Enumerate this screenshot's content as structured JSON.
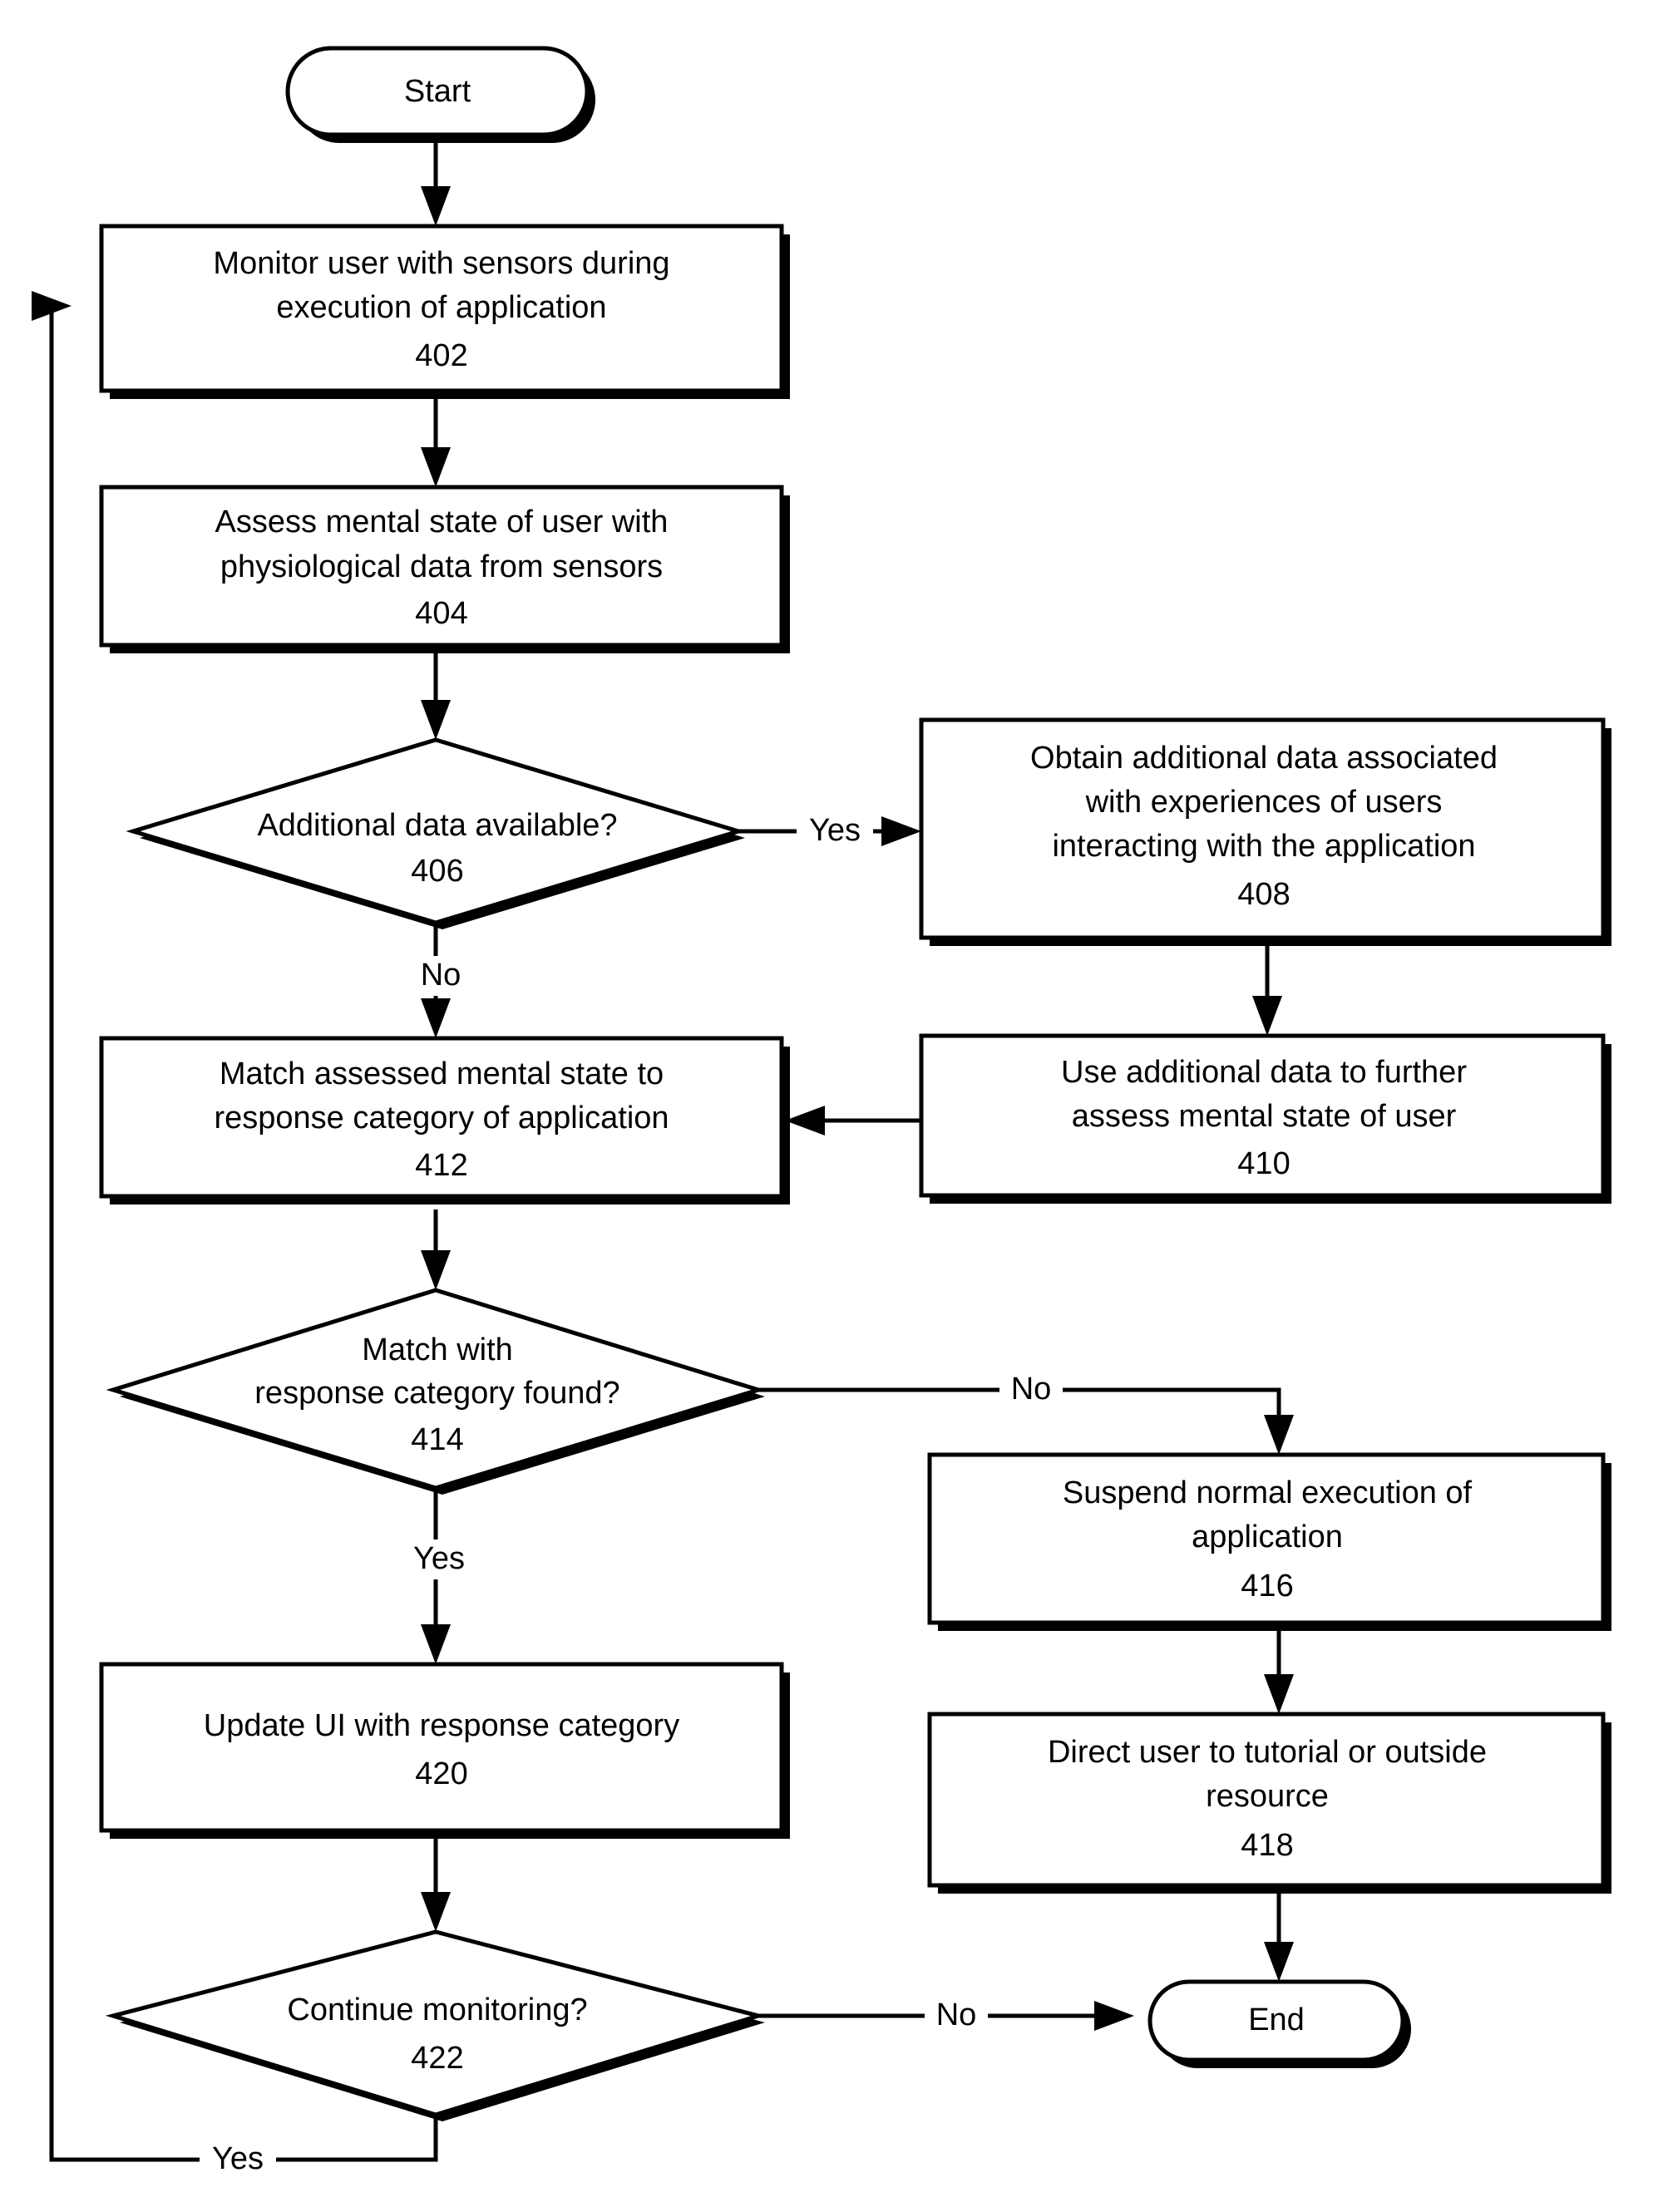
{
  "diagram": {
    "type": "flowchart",
    "title": "",
    "orientation": "top-to-bottom",
    "nodes": [
      {
        "id": "start",
        "shape": "terminator",
        "lines": [
          "Start"
        ],
        "ref": ""
      },
      {
        "id": "n402",
        "shape": "process",
        "lines": [
          "Monitor user with sensors during",
          "execution of application"
        ],
        "ref": "402"
      },
      {
        "id": "n404",
        "shape": "process",
        "lines": [
          "Assess mental state of user with",
          "physiological data from sensors"
        ],
        "ref": "404"
      },
      {
        "id": "n406",
        "shape": "decision",
        "lines": [
          "Additional data available?"
        ],
        "ref": "406"
      },
      {
        "id": "n408",
        "shape": "process",
        "lines": [
          "Obtain additional data associated",
          "with experiences of users",
          "interacting with the application"
        ],
        "ref": "408"
      },
      {
        "id": "n410",
        "shape": "process",
        "lines": [
          "Use additional data to further",
          "assess mental state of user"
        ],
        "ref": "410"
      },
      {
        "id": "n412",
        "shape": "process",
        "lines": [
          "Match assessed mental state to",
          "response category of application"
        ],
        "ref": "412"
      },
      {
        "id": "n414",
        "shape": "decision",
        "lines": [
          "Match with",
          "response category found?"
        ],
        "ref": "414"
      },
      {
        "id": "n416",
        "shape": "process",
        "lines": [
          "Suspend normal execution of",
          "application"
        ],
        "ref": "416"
      },
      {
        "id": "n418",
        "shape": "process",
        "lines": [
          "Direct user to tutorial or outside",
          "resource"
        ],
        "ref": "418"
      },
      {
        "id": "n420",
        "shape": "process",
        "lines": [
          "Update UI with response category"
        ],
        "ref": "420"
      },
      {
        "id": "n422",
        "shape": "decision",
        "lines": [
          "Continue monitoring?"
        ],
        "ref": "422"
      },
      {
        "id": "end",
        "shape": "terminator",
        "lines": [
          "End"
        ],
        "ref": ""
      }
    ],
    "edges": [
      {
        "from": "start",
        "to": "n402",
        "label": ""
      },
      {
        "from": "n402",
        "to": "n404",
        "label": ""
      },
      {
        "from": "n404",
        "to": "n406",
        "label": ""
      },
      {
        "from": "n406",
        "to": "n408",
        "label": "Yes"
      },
      {
        "from": "n406",
        "to": "n412",
        "label": "No"
      },
      {
        "from": "n408",
        "to": "n410",
        "label": ""
      },
      {
        "from": "n410",
        "to": "n412",
        "label": ""
      },
      {
        "from": "n412",
        "to": "n414",
        "label": ""
      },
      {
        "from": "n414",
        "to": "n416",
        "label": "No"
      },
      {
        "from": "n414",
        "to": "n420",
        "label": "Yes"
      },
      {
        "from": "n416",
        "to": "n418",
        "label": ""
      },
      {
        "from": "n418",
        "to": "end",
        "label": ""
      },
      {
        "from": "n420",
        "to": "n422",
        "label": ""
      },
      {
        "from": "n422",
        "to": "end",
        "label": "No"
      },
      {
        "from": "n422",
        "to": "n402",
        "label": "Yes"
      }
    ]
  },
  "text": {
    "start": "Start",
    "end": "End",
    "n402_l1": "Monitor user with sensors during",
    "n402_l2": "execution of application",
    "n402_ref": "402",
    "n404_l1": "Assess mental state of user with",
    "n404_l2": "physiological data from sensors",
    "n404_ref": "404",
    "n406_l1": "Additional data available?",
    "n406_ref": "406",
    "n408_l1": "Obtain additional data associated",
    "n408_l2": "with experiences of users",
    "n408_l3": "interacting with the application",
    "n408_ref": "408",
    "n410_l1": "Use additional data to further",
    "n410_l2": "assess mental state of user",
    "n410_ref": "410",
    "n412_l1": "Match assessed mental state to",
    "n412_l2": "response category of application",
    "n412_ref": "412",
    "n414_l1": "Match with",
    "n414_l2": "response category found?",
    "n414_ref": "414",
    "n416_l1": "Suspend normal execution of",
    "n416_l2": "application",
    "n416_ref": "416",
    "n418_l1": "Direct user to tutorial or outside",
    "n418_l2": "resource",
    "n418_ref": "418",
    "n420_l1": "Update UI with response category",
    "n420_ref": "420",
    "n422_l1": "Continue monitoring?",
    "n422_ref": "422",
    "yes_406": "Yes",
    "no_406": "No",
    "no_414": "No",
    "yes_414": "Yes",
    "no_422": "No",
    "yes_422": "Yes"
  },
  "colors": {
    "stroke": "#000000",
    "fill": "#ffffff",
    "background": "#ffffff"
  }
}
